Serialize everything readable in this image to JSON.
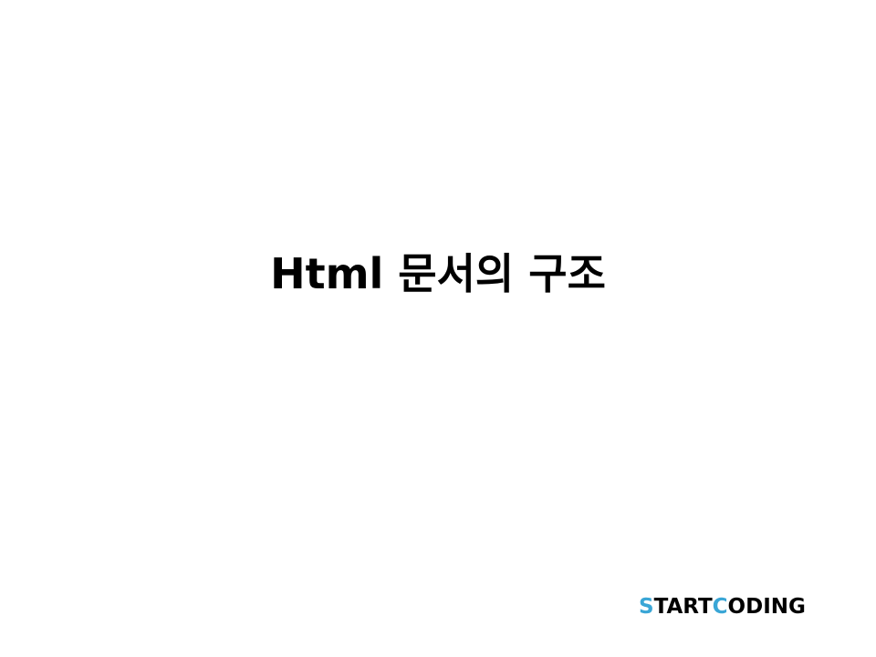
{
  "slide": {
    "title": "Html 문서의 구조"
  },
  "logo": {
    "text": "STARTCODING",
    "part1_accent": "S",
    "part2": "TART",
    "part3_accent": "C",
    "part4": "ODING",
    "accent_color": "#3aa6d6",
    "text_color": "#000000"
  }
}
